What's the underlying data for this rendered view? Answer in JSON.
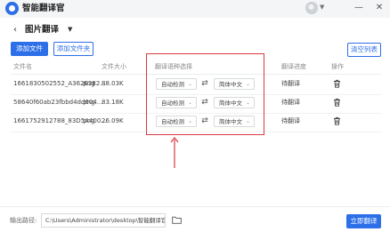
{
  "app": {
    "title": "智能翻译官"
  },
  "page": {
    "title": "图片翻译"
  },
  "toolbar": {
    "add_file": "添加文件",
    "add_folder": "添加文件夹",
    "clear_list": "清空列表"
  },
  "table": {
    "columns": [
      "文件名",
      "文件大小",
      "翻译语种选择",
      "翻译进度",
      "操作"
    ],
    "rows": [
      {
        "name": "1661830502552_A362E282...",
        "ext": ".png",
        "size": "88.03K",
        "source_lang": "自动检测",
        "target_lang": "简体中文",
        "status": "待翻译"
      },
      {
        "name": "58640f60ab23fbbd4dd604...",
        "ext": ".png",
        "size": "83.18K",
        "source_lang": "自动检测",
        "target_lang": "简体中文",
        "status": "待翻译"
      },
      {
        "name": "1661752912788_83D5A400...",
        "ext": ".png",
        "size": "26.09K",
        "source_lang": "自动检测",
        "target_lang": "简体中文",
        "status": "待翻译"
      }
    ]
  },
  "footer": {
    "output_label": "输出路径:",
    "output_path": "C:\\Users\\Administrator\\desktop\\智能翻译官",
    "translate_now": "立即翻译"
  },
  "colors": {
    "accent": "#2d6fe8",
    "highlight": "#d8393f"
  },
  "icons": [
    "app-logo-icon",
    "avatar-icon",
    "chevron-down-icon",
    "minimize-icon",
    "close-icon",
    "back-arrow-icon",
    "swap-icon",
    "trash-icon",
    "folder-icon",
    "arrow-up-icon"
  ]
}
